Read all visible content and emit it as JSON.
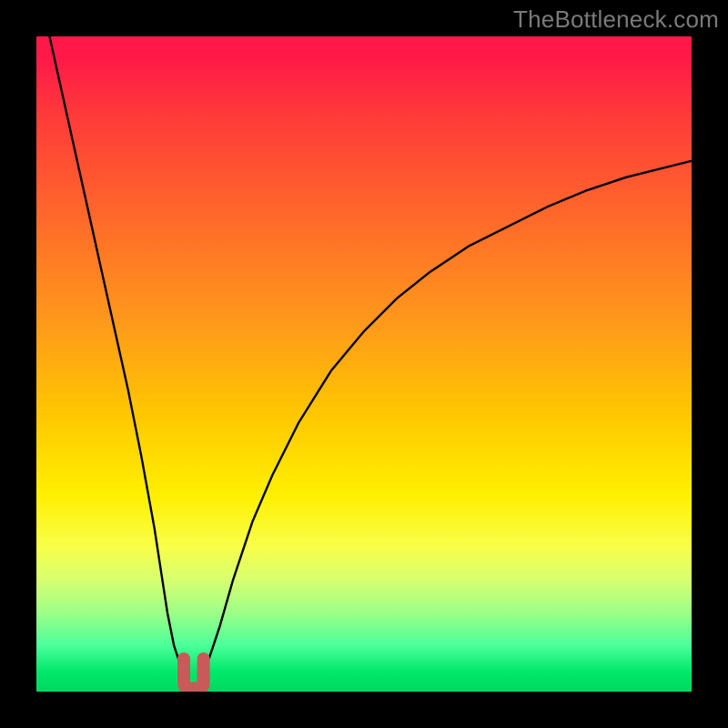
{
  "watermark": "TheBottleneck.com",
  "colors": {
    "frame": "#000000",
    "curve": "#000000",
    "marker": "#c85a5a",
    "gradient_top": "#ff1848",
    "gradient_bottom": "#00d860"
  },
  "chart_data": {
    "type": "line",
    "title": "",
    "xlabel": "",
    "ylabel": "",
    "xlim": [
      0,
      100
    ],
    "ylim": [
      0,
      100
    ],
    "legend": false,
    "grid": false,
    "series": [
      {
        "name": "left-branch",
        "x": [
          2,
          4,
          6,
          8,
          10,
          12,
          14,
          16,
          18,
          20,
          21,
          22,
          23
        ],
        "values": [
          100,
          91,
          82,
          73,
          64,
          55,
          46,
          36,
          25,
          12,
          7,
          4,
          2
        ]
      },
      {
        "name": "right-branch",
        "x": [
          25,
          26,
          27,
          28,
          30,
          33,
          36,
          40,
          45,
          50,
          55,
          60,
          66,
          72,
          78,
          84,
          90,
          96,
          100
        ],
        "values": [
          2,
          4,
          7,
          10,
          17,
          26,
          33,
          41,
          49,
          55,
          60,
          64,
          68,
          71,
          74,
          76.5,
          78.5,
          80,
          81
        ]
      }
    ],
    "markers": {
      "name": "valley-marker",
      "shape": "u",
      "x_range": [
        22.5,
        25.5
      ],
      "y_range": [
        0.5,
        5
      ],
      "color": "#c85a5a"
    },
    "annotations": []
  }
}
